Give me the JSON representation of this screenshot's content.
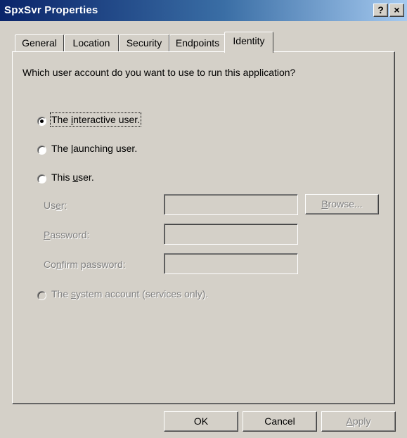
{
  "window": {
    "title": "SpxSvr Properties",
    "help_button": "?",
    "close_button": "×"
  },
  "tabs": [
    {
      "label": "General",
      "active": false
    },
    {
      "label": "Location",
      "active": false
    },
    {
      "label": "Security",
      "active": false
    },
    {
      "label": "Endpoints",
      "active": false
    },
    {
      "label": "Identity",
      "active": true
    }
  ],
  "identity": {
    "question": "Which user account do you want to use to run this application?",
    "options": [
      {
        "pre": "The ",
        "key": "i",
        "post": "nteractive user.",
        "checked": true,
        "enabled": true
      },
      {
        "pre": "The ",
        "key": "l",
        "post": "aunching user.",
        "checked": false,
        "enabled": true
      },
      {
        "pre": "This ",
        "key": "u",
        "post": "ser.",
        "checked": false,
        "enabled": true
      },
      {
        "pre": "The ",
        "key": "s",
        "post": "ystem account (services only).",
        "checked": false,
        "enabled": false
      }
    ],
    "fields": [
      {
        "pre": "Us",
        "key": "e",
        "post": "r:",
        "value": ""
      },
      {
        "pre": "",
        "key": "P",
        "post": "assword:",
        "value": ""
      },
      {
        "pre": "Co",
        "key": "n",
        "post": "firm password:",
        "value": ""
      }
    ],
    "browse_button": {
      "pre": "",
      "key": "B",
      "post": "rowse...",
      "enabled": false
    }
  },
  "buttons": {
    "ok": "OK",
    "cancel": "Cancel",
    "apply": {
      "pre": "",
      "key": "A",
      "post": "pply",
      "enabled": false
    }
  },
  "colors": {
    "face": "#d4d0c8",
    "titlebar_start": "#0a246a",
    "titlebar_end": "#a6caf0",
    "disabled_text": "#808080"
  }
}
